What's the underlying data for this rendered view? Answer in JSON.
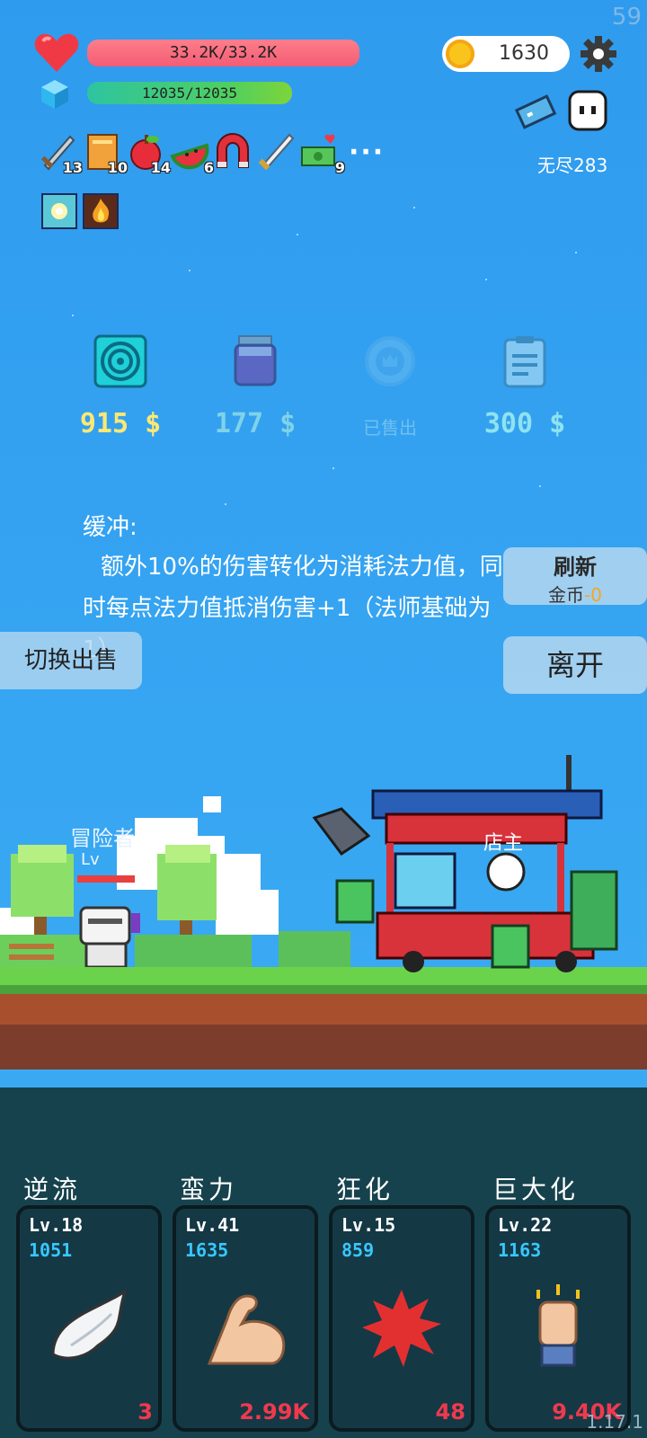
{
  "status": {
    "fps": "59",
    "hp_text": "33.2K/33.2K",
    "mp_text": "12035/12035",
    "gold": "1630",
    "endless_label": "无尽283",
    "version": "1.17.1"
  },
  "inventory": [
    {
      "icon": "sword-icon",
      "count": "13"
    },
    {
      "icon": "book-icon",
      "count": "10"
    },
    {
      "icon": "apple-icon",
      "count": "14"
    },
    {
      "icon": "watermelon-icon",
      "count": "6"
    },
    {
      "icon": "magnet-icon",
      "count": ""
    },
    {
      "icon": "blade-icon",
      "count": ""
    },
    {
      "icon": "money-heart-icon",
      "count": "9"
    }
  ],
  "more_label": "···",
  "shop_items": [
    {
      "icon": "target-icon",
      "price": "915 $",
      "sold": false,
      "price_color": "#ffe873"
    },
    {
      "icon": "jar-icon",
      "price": "177 $",
      "sold": false,
      "price_color": "#7fd3e8"
    },
    {
      "icon": "crown-icon",
      "price": "已售出",
      "sold": true,
      "price_color": "#6fc0ef"
    },
    {
      "icon": "clipboard-icon",
      "price": "300 $",
      "sold": false,
      "price_color": "#8fe3ee"
    }
  ],
  "description": {
    "title": "缓冲:",
    "body": "额外10%的伤害转化为消耗法力值，同时每点法力值抵消伤害+1（法师基础为1）"
  },
  "buttons": {
    "refresh_label": "刷新",
    "refresh_cost_label": "金币",
    "refresh_cost_value": "-0",
    "leave_label": "离开",
    "switch_label": "切换出售"
  },
  "scene": {
    "player_label": "冒险者",
    "player_level": "Lv",
    "shop_sign": "店主"
  },
  "skills": [
    {
      "name": "逆流",
      "level": "Lv.18",
      "value": "1051",
      "cost": "3",
      "icon": "wing-icon"
    },
    {
      "name": "蛮力",
      "level": "Lv.41",
      "value": "1635",
      "cost": "2.99K",
      "icon": "muscle-icon"
    },
    {
      "name": "狂化",
      "level": "Lv.15",
      "value": "859",
      "cost": "48",
      "icon": "splat-icon"
    },
    {
      "name": "巨大化",
      "level": "Lv.22",
      "value": "1163",
      "cost": "9.40K",
      "icon": "fist-icon"
    }
  ],
  "colors": {
    "sky": "#37a6f2",
    "hp": "#f35c75",
    "mp": "#4fd05f",
    "cost_red": "#f0394e",
    "skill_value": "#37c8ff"
  }
}
